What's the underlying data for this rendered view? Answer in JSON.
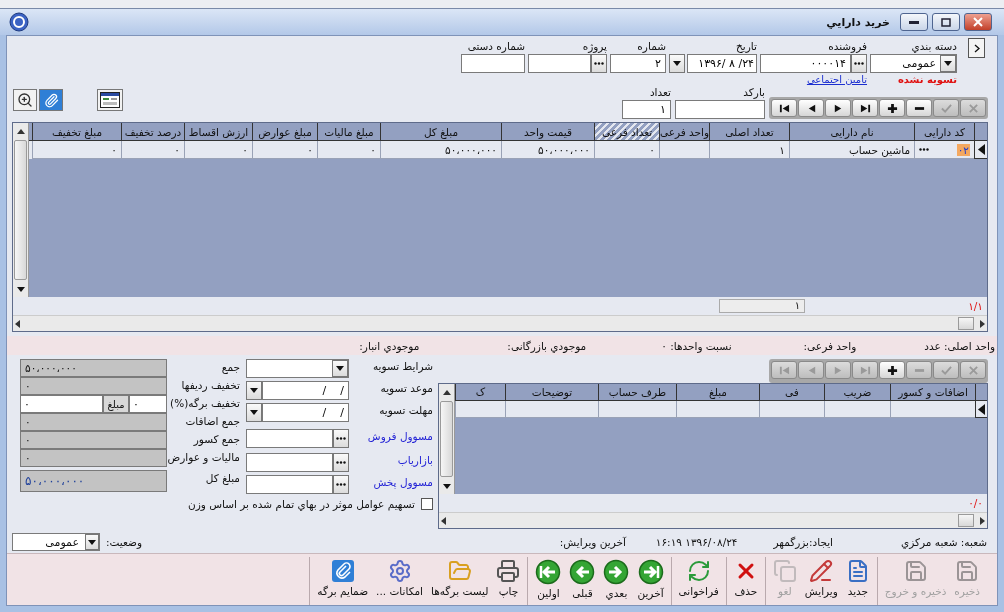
{
  "window": {
    "title": "خريد دارايي"
  },
  "header": {
    "fields": [
      {
        "kind": "combo",
        "label": "دسته بندي",
        "value": "عمومی",
        "note": {
          "kind": "status",
          "text": "تسویه نشده"
        }
      },
      {
        "kind": "lookup",
        "label": "فروشنده",
        "value": "۰۰۰۰۱۴",
        "note": {
          "kind": "link",
          "text": "تامین اجتماعی"
        }
      },
      {
        "kind": "date",
        "label": "تاریخ",
        "value": "۱۳۹۶/ ۸ /۲۴"
      },
      {
        "kind": "text",
        "label": "شماره",
        "value": "۲"
      },
      {
        "kind": "lookup",
        "label": "پروژه"
      },
      {
        "kind": "text",
        "label": "شماره دستی"
      }
    ]
  },
  "nav": [
    {
      "kind": "first",
      "disabled": false
    },
    {
      "kind": "prev",
      "disabled": false
    },
    {
      "kind": "next",
      "disabled": false
    },
    {
      "kind": "last",
      "disabled": false
    },
    {
      "kind": "add",
      "disabled": false
    },
    {
      "kind": "remove",
      "disabled": false
    },
    {
      "kind": "post",
      "disabled": true
    },
    {
      "kind": "cancel",
      "disabled": true
    }
  ],
  "barcode": {
    "label": "بارکد"
  },
  "quantity": {
    "label": "تعداد",
    "value": "۱"
  },
  "items_table": {
    "columns": [
      {
        "label": "کد دارایی",
        "hatched": false
      },
      {
        "label": "نام دارایی",
        "hatched": false
      },
      {
        "label": "تعداد اصلی",
        "hatched": false
      },
      {
        "label": "واحد فرعی",
        "hatched": false
      },
      {
        "label": "تعداد فرعی",
        "hatched": true
      },
      {
        "label": "قیمت واحد",
        "hatched": false
      },
      {
        "label": "مبلغ کل",
        "hatched": false
      },
      {
        "label": "مبلغ مالیات",
        "hatched": false
      },
      {
        "label": "مبلغ عوارض",
        "hatched": false
      },
      {
        "label": "ارزش اقساط",
        "hatched": false
      },
      {
        "label": "درصد تخفیف",
        "hatched": false
      },
      {
        "label": "مبلغ تخفیف",
        "hatched": false
      }
    ],
    "rows": [
      {
        "selected": true,
        "cells": [
          "۰۲",
          "ماشین حساب",
          "۱",
          null,
          "۰",
          "۵۰،۰۰۰،۰۰۰",
          "۵۰،۰۰۰،۰۰۰",
          "۰",
          "۰",
          "۰",
          "۰",
          "۰"
        ]
      }
    ],
    "pager": "۱/۱",
    "record_count": "۱"
  },
  "unit_info": [
    "واحد اصلی: عدد",
    "واحد فرعی:",
    "نسبت واحدها: ۰",
    "موجودي بازرگانی:",
    "موجودي انبار:"
  ],
  "totals": [
    {
      "kind": "readonly",
      "label": "جمع",
      "value": "۵۰،۰۰۰،۰۰۰"
    },
    {
      "kind": "readonly",
      "label": "تخفیف ردیفها",
      "value": "۰"
    },
    {
      "kind": "discount",
      "label": "تخفیف برگه(%)",
      "percent": "۰",
      "unit": "مبلغ",
      "amount": "۰"
    },
    {
      "kind": "readonly",
      "label": "جمع اضافات",
      "value": "۰"
    },
    {
      "kind": "readonly",
      "label": "جمع کسور",
      "value": "۰"
    },
    {
      "kind": "readonly",
      "label": "مالیات و عوارض",
      "value": "۰"
    },
    {
      "kind": "grand",
      "label": "مبلغ کل",
      "value": "۵۰،۰۰۰،۰۰۰"
    }
  ],
  "settlement": [
    {
      "kind": "combo",
      "label": "شرایط تسویه",
      "link": false
    },
    {
      "kind": "date",
      "label": "موعد تسویه",
      "value": "/    /",
      "link": false
    },
    {
      "kind": "date",
      "label": "مهلت تسویه",
      "value": "/    /",
      "link": false
    },
    {
      "kind": "lookup",
      "label": "مسوول فروش",
      "link": true
    },
    {
      "kind": "lookup",
      "label": "بازاریاب",
      "link": true
    },
    {
      "kind": "lookup",
      "label": "مسوول پخش",
      "link": true
    }
  ],
  "allocation": {
    "label": "تسهیم عوامل موثر در بهاي تمام شده بر اساس وزن",
    "checked": false
  },
  "charges_table": {
    "nav": [
      {
        "kind": "first",
        "disabled": true
      },
      {
        "kind": "prev",
        "disabled": true
      },
      {
        "kind": "next",
        "disabled": true
      },
      {
        "kind": "last",
        "disabled": true
      },
      {
        "kind": "add",
        "disabled": false
      },
      {
        "kind": "remove",
        "disabled": true
      },
      {
        "kind": "post",
        "disabled": true
      },
      {
        "kind": "cancel",
        "disabled": true
      }
    ],
    "columns": [
      "اضافات و کسور",
      "ضریب",
      "فی",
      "مبلغ",
      "طرف حساب",
      "توضیحات",
      "ک"
    ],
    "rows": [
      {
        "selected": true
      }
    ],
    "pager": "۰/۰"
  },
  "status_bar": {
    "branch": "شعبه: شعبه مرکزي",
    "created": "ایجاد:بزرگمهر",
    "timestamp": "۱۳۹۶/۰۸/۲۴ ۱۶:۱۹",
    "last_edit": "آخرین ویرایش:",
    "state_label": "وضعیت:",
    "state_value": "عمومی"
  },
  "actions": [
    [
      {
        "kind": "save",
        "label": "ذخیره",
        "disabled": true
      },
      {
        "kind": "save_exit",
        "label": "ذخیره و خروج",
        "disabled": true
      }
    ],
    [
      {
        "kind": "new",
        "label": "جدید",
        "disabled": false
      },
      {
        "kind": "edit",
        "label": "ویرایش",
        "disabled": false
      },
      {
        "kind": "undo",
        "label": "لغو",
        "disabled": true
      }
    ],
    [
      {
        "kind": "delete",
        "label": "حذف",
        "disabled": false
      }
    ],
    [
      {
        "kind": "reload",
        "label": "فراخوانی",
        "disabled": false
      }
    ],
    [
      {
        "kind": "last",
        "label": "آخرین",
        "disabled": false
      },
      {
        "kind": "next",
        "label": "بعدي",
        "disabled": false
      },
      {
        "kind": "prev",
        "label": "قبلی",
        "disabled": false
      },
      {
        "kind": "first",
        "label": "اولین",
        "disabled": false
      }
    ],
    [
      {
        "kind": "print",
        "label": "چاپ",
        "disabled": false
      },
      {
        "kind": "list",
        "label": "لیست برگه‌ها",
        "disabled": false
      },
      {
        "kind": "options",
        "label": "امکانات ...",
        "disabled": false
      },
      {
        "kind": "attach",
        "label": "ضمایم برگه",
        "disabled": false
      }
    ]
  ]
}
